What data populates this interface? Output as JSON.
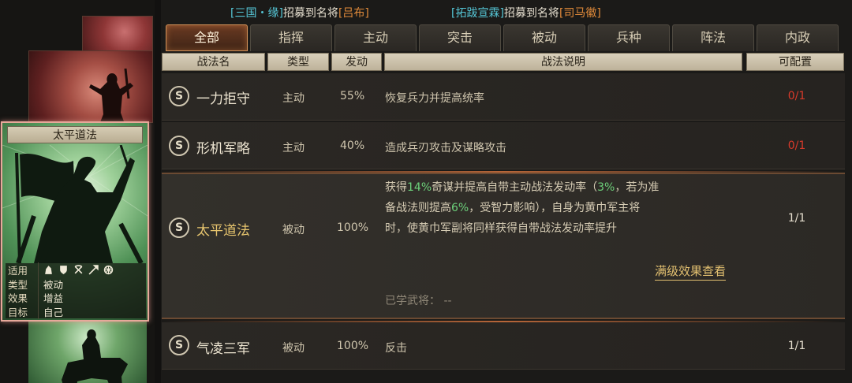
{
  "recruit": {
    "part1_open": "[",
    "part1_name": "三国・缘",
    "part1_close": "]",
    "part1_text": "招募到名将",
    "part1_general_open": "[",
    "part1_general": "吕布",
    "part1_general_close": "]",
    "part2_open": "[",
    "part2_name": "拓跋宣霖",
    "part2_close": "]",
    "part2_text": "招募到名将",
    "part2_general_open": "[",
    "part2_general": "司马徽",
    "part2_general_close": "]"
  },
  "tabs": [
    {
      "label": "全部",
      "active": true
    },
    {
      "label": "指挥"
    },
    {
      "label": "主动"
    },
    {
      "label": "突击"
    },
    {
      "label": "被动"
    },
    {
      "label": "兵种"
    },
    {
      "label": "阵法"
    },
    {
      "label": "内政"
    }
  ],
  "columns": {
    "name": "战法名",
    "type": "类型",
    "rate": "发动",
    "desc": "战法说明",
    "config": "可配置"
  },
  "card": {
    "title": "太平道法",
    "applies_label": "适用",
    "type_label": "类型",
    "type_value": "被动",
    "effect_label": "效果",
    "effect_value": "增益",
    "target_label": "目标",
    "target_value": "自己",
    "unit_icons": [
      "cavalry-icon",
      "shield-icon",
      "bow-icon",
      "spear-icon",
      "wheel-icon"
    ]
  },
  "rows": [
    {
      "badge": "S",
      "name": "一力拒守",
      "type": "主动",
      "rate": "55%",
      "desc": "恢复兵力并提高统率",
      "config": "0/1"
    },
    {
      "badge": "S",
      "name": "形机军略",
      "type": "主动",
      "rate": "40%",
      "desc": "造成兵刃攻击及谋略攻击",
      "config": "0/1"
    },
    {
      "badge": "S",
      "name": "太平道法",
      "type": "被动",
      "rate": "100%",
      "config": "1/1",
      "desc_l1_a": "获得",
      "desc_l1_h1": "14%",
      "desc_l1_b": "奇谋并提高自带主动战法发动率（",
      "desc_l1_h2": "3%",
      "desc_l1_c": "，若为准",
      "desc_l2_a": "备战法则提高",
      "desc_l2_h": "6%",
      "desc_l2_b": "，受智力影响），自身为黄巾军主将",
      "desc_l3": "时，使黄巾军副将同样获得自带战法发动率提升",
      "view_full": "满级效果查看",
      "learned_label": "已学武将：",
      "learned_value": "--"
    },
    {
      "badge": "S",
      "name": "气凌三军",
      "type": "被动",
      "rate": "100%",
      "desc": "反击",
      "config": "1/1"
    }
  ],
  "colors": {
    "accent": "#d4935a",
    "config_unavailable": "#d93a2a",
    "highlight_value": "#6cd07a",
    "link": "#e3c070"
  }
}
